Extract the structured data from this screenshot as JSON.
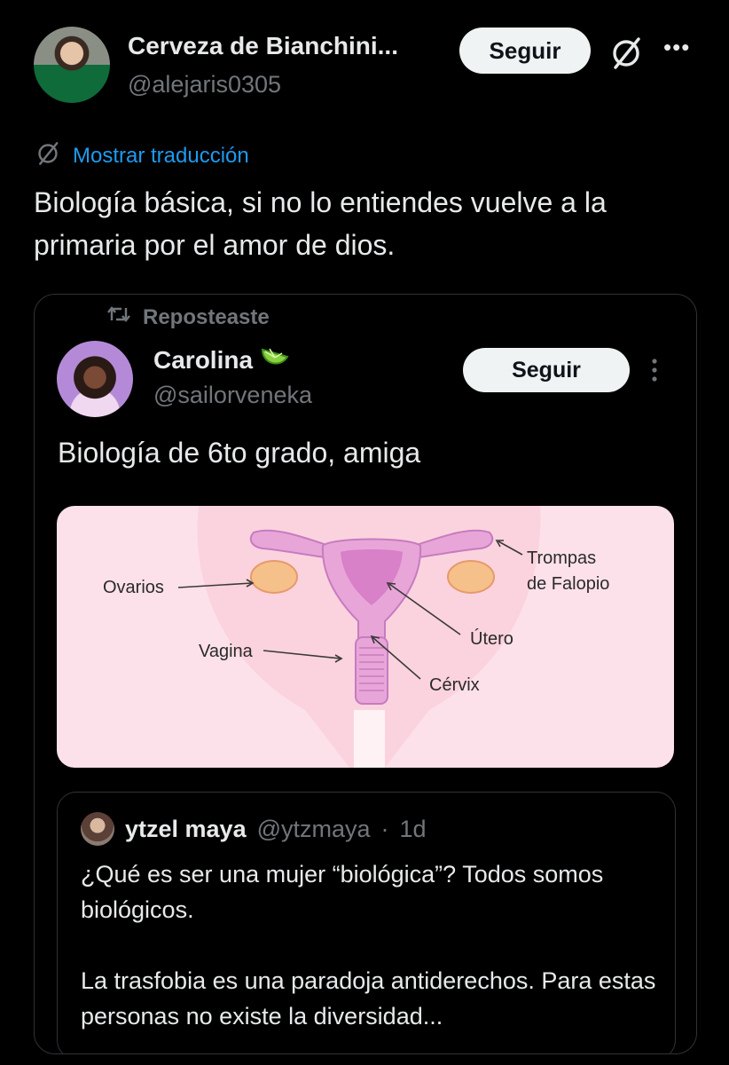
{
  "post": {
    "author_name": "Cerveza de Bianchini...",
    "author_handle": "@alejaris0305",
    "follow_label": "Seguir",
    "more_label": "•••",
    "translate_label": "Mostrar traducción",
    "text": "Biología básica, si no lo entiendes vuelve a la primaria por el amor de dios."
  },
  "quote": {
    "repost_label": "Reposteaste",
    "author_name": "Carolina",
    "author_emoji": "lime-icon",
    "author_handle": "@sailorveneka",
    "follow_label": "Seguir",
    "text": "Biología de 6to grado, amiga",
    "diagram": {
      "labels": {
        "ovarios": "Ovarios",
        "trompas_1": "Trompas",
        "trompas_2": "de Falopio",
        "utero": "Útero",
        "vagina": "Vagina",
        "cervix": "Cérvix"
      },
      "background_color": "#fde1ea"
    },
    "inner": {
      "author_name": "ytzel maya",
      "author_handle": "@ytzmaya",
      "separator": "·",
      "time": "1d",
      "paragraph_1": "¿Qué es ser una mujer “biológica”? Todos somos biológicos.",
      "paragraph_2": "La trasfobia es una paradoja antiderechos. Para estas personas no existe la diversidad..."
    }
  },
  "colors": {
    "background": "#000000",
    "text": "#e7e9ea",
    "secondary": "#71767b",
    "link": "#1d9bf0",
    "border": "#2f3336"
  }
}
